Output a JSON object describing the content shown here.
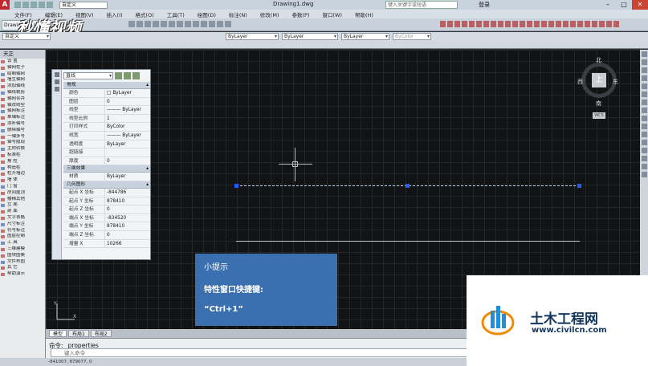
{
  "title_bar": {
    "workspace": "自定义",
    "document": "Drawing1.dwg",
    "search_placeholder": "键入关键字或短语",
    "user": "登录"
  },
  "menu": [
    "文件(F)",
    "编辑(E)",
    "视图(V)",
    "插入(I)",
    "格式(O)",
    "工具(T)",
    "绘图(D)",
    "标注(N)",
    "修改(M)",
    "参数(P)",
    "窗口(W)",
    "帮助(H)"
  ],
  "ribbon": {
    "tab": "Drawin"
  },
  "watermark": "秒懂视频",
  "toolbar": {
    "workspace_dropdown": "自定义",
    "color_dropdown": "ByLayer",
    "linetype_dropdown": "ByLayer",
    "lineweight_dropdown": "ByLayer",
    "plotstyle_dropdown": "ByColor"
  },
  "palette": {
    "header": "天正",
    "items": [
      "设 置",
      "轴网柱子",
      "绘制轴网",
      "墙生轴网",
      "添加轴线",
      "轴线裁剪",
      "轴网合并",
      "轴改线型",
      "轴网标注",
      "单轴标注",
      "添补轴号",
      "删除轴号",
      "一轴多号",
      "轴号隐现",
      "主附转换",
      "标准柱",
      "角 柱",
      "构造柱",
      "柱齐墙边",
      "墙 体",
      "门 窗",
      "房间屋顶",
      "楼梯其他",
      "立 面",
      "剖 面",
      "文字表格",
      "尺寸标注",
      "符号标注",
      "图层控制",
      "工 具",
      "三维建模",
      "图块图案",
      "文件布图",
      "其 它",
      "帮助演示"
    ]
  },
  "properties": {
    "selector": "直线",
    "categories": [
      {
        "name": "常规",
        "rows": [
          {
            "key": "颜色",
            "value": "□ ByLayer"
          },
          {
            "key": "图层",
            "value": "0"
          },
          {
            "key": "线型",
            "value": "——— ByLayer"
          },
          {
            "key": "线型比例",
            "value": "1"
          },
          {
            "key": "打印样式",
            "value": "ByColor"
          },
          {
            "key": "线宽",
            "value": "——— ByLayer"
          },
          {
            "key": "透明度",
            "value": "ByLayer"
          },
          {
            "key": "超链接",
            "value": ""
          },
          {
            "key": "厚度",
            "value": "0"
          }
        ]
      },
      {
        "name": "三维效果",
        "rows": [
          {
            "key": "材质",
            "value": "ByLayer"
          }
        ]
      },
      {
        "name": "几何图形",
        "rows": [
          {
            "key": "起点 X 坐标",
            "value": "-844786"
          },
          {
            "key": "起点 Y 坐标",
            "value": "878410"
          },
          {
            "key": "起点 Z 坐标",
            "value": "0"
          },
          {
            "key": "端点 X 坐标",
            "value": "-834520"
          },
          {
            "key": "端点 Y 坐标",
            "value": "878410"
          },
          {
            "key": "端点 Z 坐标",
            "value": "0"
          },
          {
            "key": "增量 X",
            "value": "10266"
          }
        ]
      }
    ]
  },
  "viewcube": {
    "north": "北",
    "south": "南",
    "east": "东",
    "west": "西",
    "top": "上",
    "wcs": "WCS"
  },
  "tip": {
    "heading": "小提示",
    "line1": "特性窗口快捷键:",
    "line2": "“Ctrl+1”"
  },
  "layout_tabs": [
    "模型",
    "布局1",
    "布局2"
  ],
  "command": {
    "history": "命令: _properties",
    "placeholder": "键入命令"
  },
  "status": "-841007, 879077, 0",
  "brand": {
    "name": "土木工程网",
    "url": "www.civilcn.com"
  }
}
